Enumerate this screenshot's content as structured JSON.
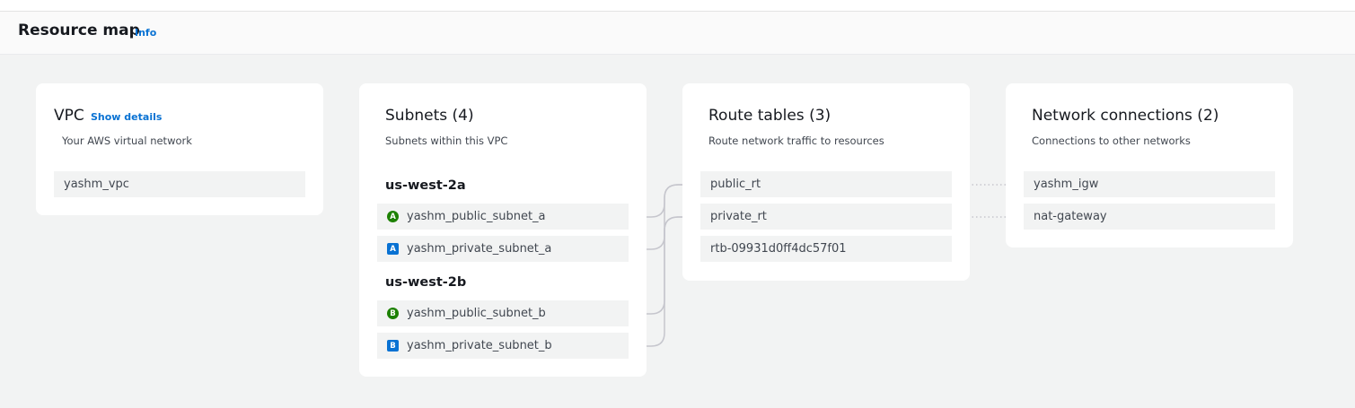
{
  "header": {
    "title": "Resource map",
    "info_link": "Info"
  },
  "vpc": {
    "title": "VPC",
    "show_details": "Show details",
    "subtitle": "Your AWS virtual network",
    "items": [
      "yashm_vpc"
    ]
  },
  "subnets": {
    "title": "Subnets (4)",
    "subtitle": "Subnets within this VPC",
    "zones": [
      {
        "name": "us-west-2a",
        "items": [
          {
            "badge": "A",
            "type": "public",
            "label": "yashm_public_subnet_a"
          },
          {
            "badge": "A",
            "type": "private",
            "label": "yashm_private_subnet_a"
          }
        ]
      },
      {
        "name": "us-west-2b",
        "items": [
          {
            "badge": "B",
            "type": "public",
            "label": "yashm_public_subnet_b"
          },
          {
            "badge": "B",
            "type": "private",
            "label": "yashm_private_subnet_b"
          }
        ]
      }
    ]
  },
  "route_tables": {
    "title": "Route tables (3)",
    "subtitle": "Route network traffic to resources",
    "items": [
      "public_rt",
      "private_rt",
      "rtb-09931d0ff4dc57f01"
    ]
  },
  "network_connections": {
    "title": "Network connections (2)",
    "subtitle": "Connections to other networks",
    "items": [
      "yashm_igw",
      "nat-gateway"
    ]
  },
  "colors": {
    "accent": "#0972d3",
    "public_badge": "#1d8102",
    "private_badge": "#0972d3",
    "connector": "#c6c6cd"
  }
}
